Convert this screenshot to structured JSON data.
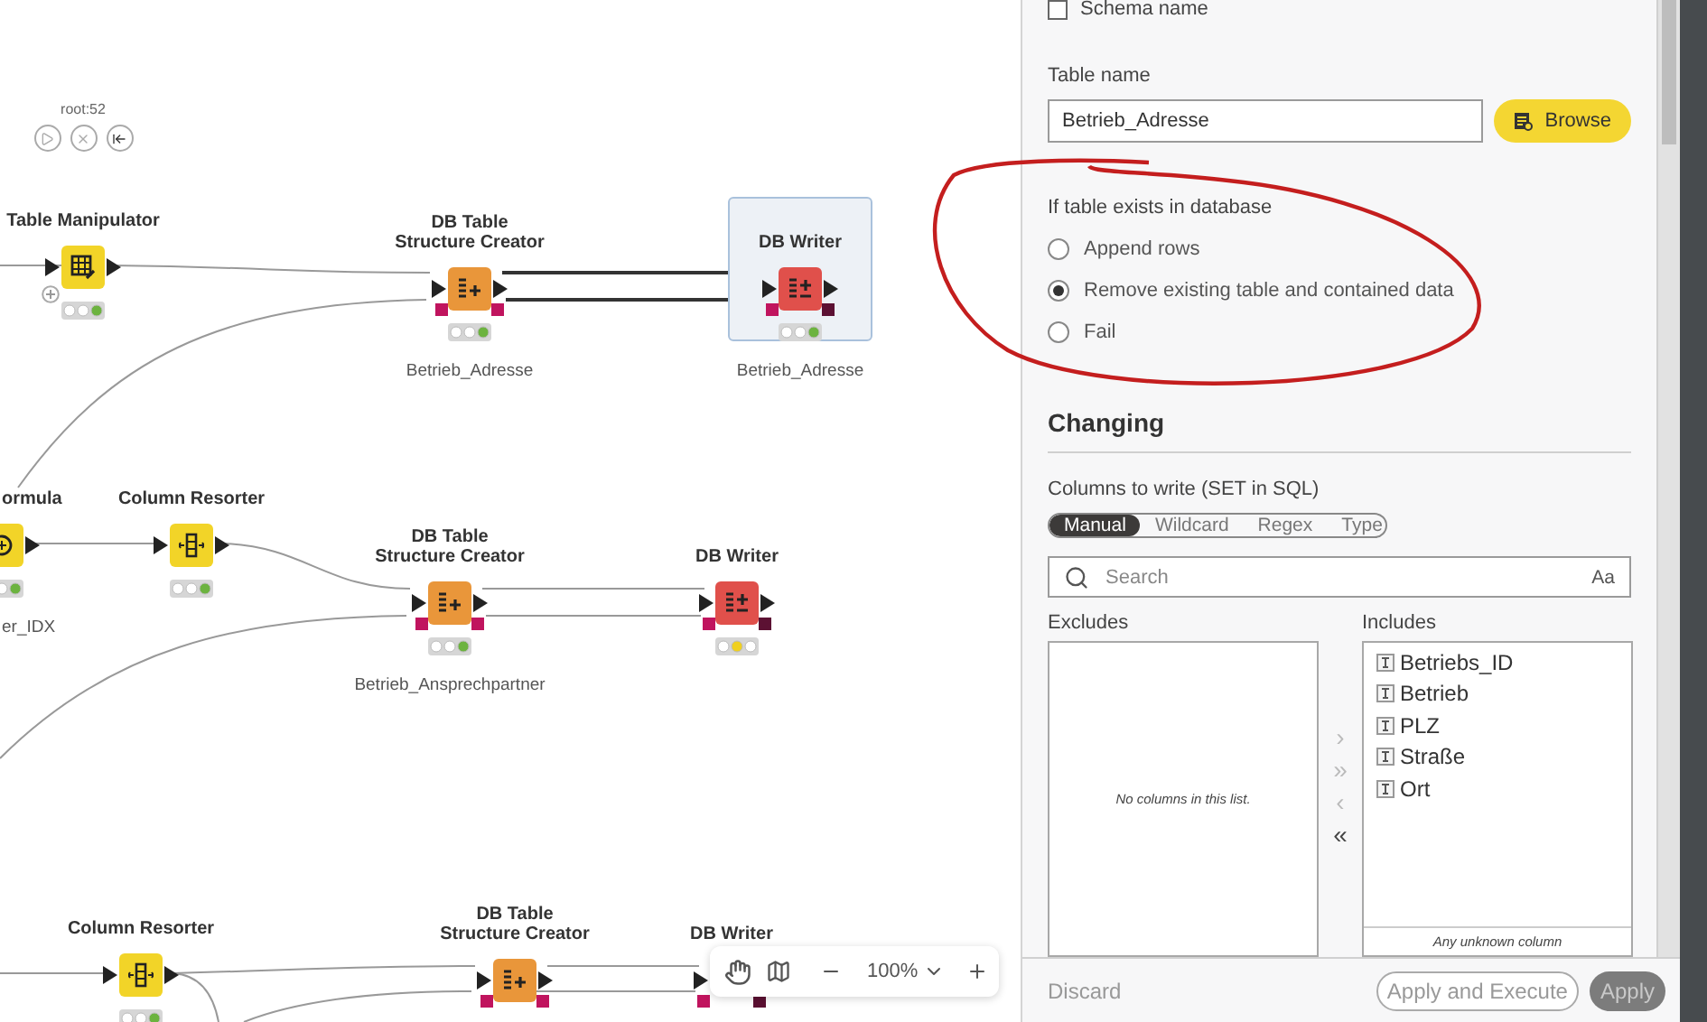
{
  "canvas": {
    "nodes": [
      {
        "title": "Table Manipulator",
        "kind": "manipulator",
        "executed": true,
        "selected": false,
        "caption": "root:52"
      },
      {
        "title": "DB Table Structure Creator",
        "kind": "creator",
        "executed": true,
        "selected": false,
        "label": "Betrieb_Adresse"
      },
      {
        "title": "DB Writer",
        "kind": "writer",
        "executed": true,
        "selected": true,
        "label": "Betrieb_Adresse"
      },
      {
        "title": "ormula",
        "kind": "formula",
        "executed": true,
        "selected": false,
        "label": "er_IDX"
      },
      {
        "title": "Column Resorter",
        "kind": "resorter",
        "executed": true,
        "selected": false
      },
      {
        "title": "DB Table Structure Creator",
        "kind": "creator",
        "executed": true,
        "selected": false,
        "label": "Betrieb_Ansprechpartner"
      },
      {
        "title": "DB Writer",
        "kind": "writer",
        "executed": false,
        "selected": false
      },
      {
        "title": "Column Resorter",
        "kind": "resorter",
        "executed": true,
        "selected": false
      },
      {
        "title": "DB Table Structure Creator",
        "kind": "creator",
        "selected": false
      },
      {
        "title": "DB Writer",
        "kind": "writer",
        "selected": false
      }
    ],
    "zoom_toolbar": {
      "zoom": "100%"
    }
  },
  "panel": {
    "schema_checkbox": {
      "label": "Schema name",
      "checked": false
    },
    "table_name": {
      "label": "Table name",
      "value": "Betrieb_Adresse",
      "browse": "Browse"
    },
    "if_exists": {
      "label": "If table exists in database",
      "options": [
        {
          "label": "Append rows",
          "selected": false
        },
        {
          "label": "Remove existing table and contained data",
          "selected": true
        },
        {
          "label": "Fail",
          "selected": false
        }
      ]
    },
    "section_title": "Changing",
    "columns": {
      "label": "Columns to write (SET in SQL)",
      "modes": [
        {
          "label": "Manual",
          "selected": true
        },
        {
          "label": "Wildcard",
          "selected": false
        },
        {
          "label": "Regex",
          "selected": false
        },
        {
          "label": "Type",
          "selected": false
        }
      ],
      "search": {
        "placeholder": "Search",
        "case_toggle": "Aa"
      },
      "excludes": {
        "title": "Excludes",
        "empty_text": "No columns in this list."
      },
      "move_buttons": [
        {
          "symbol": "›",
          "disabled": true
        },
        {
          "symbol": "»",
          "disabled": true
        },
        {
          "symbol": "‹",
          "disabled": true
        },
        {
          "symbol": "«",
          "disabled": false
        }
      ],
      "includes": {
        "title": "Includes",
        "items": [
          "Betriebs_ID",
          "Betrieb",
          "PLZ",
          "Straße",
          "Ort"
        ],
        "footer": "Any unknown column"
      }
    },
    "footer": {
      "discard": "Discard",
      "apply_execute": "Apply and Execute",
      "apply": {
        "label": "Apply",
        "disabled": true
      }
    }
  }
}
